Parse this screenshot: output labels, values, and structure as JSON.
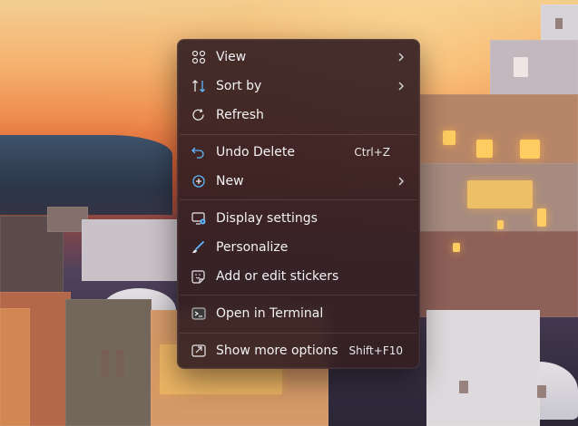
{
  "context_menu": {
    "items": [
      {
        "label": "View",
        "icon": "grid-icon",
        "submenu": true
      },
      {
        "label": "Sort by",
        "icon": "sort-icon",
        "submenu": true
      },
      {
        "label": "Refresh",
        "icon": "refresh-icon"
      },
      {
        "label": "Undo Delete",
        "icon": "undo-icon",
        "shortcut": "Ctrl+Z"
      },
      {
        "label": "New",
        "icon": "new-icon",
        "submenu": true
      },
      {
        "label": "Display settings",
        "icon": "display-settings-icon"
      },
      {
        "label": "Personalize",
        "icon": "brush-icon"
      },
      {
        "label": "Add or edit stickers",
        "icon": "sticker-icon"
      },
      {
        "label": "Open in Terminal",
        "icon": "terminal-icon"
      },
      {
        "label": "Show more options",
        "icon": "more-options-icon",
        "shortcut": "Shift+F10"
      }
    ]
  },
  "colors": {
    "menu_background": "#341f23",
    "accent": "#5eb7ff",
    "menu_text": "#f2f2f2"
  }
}
